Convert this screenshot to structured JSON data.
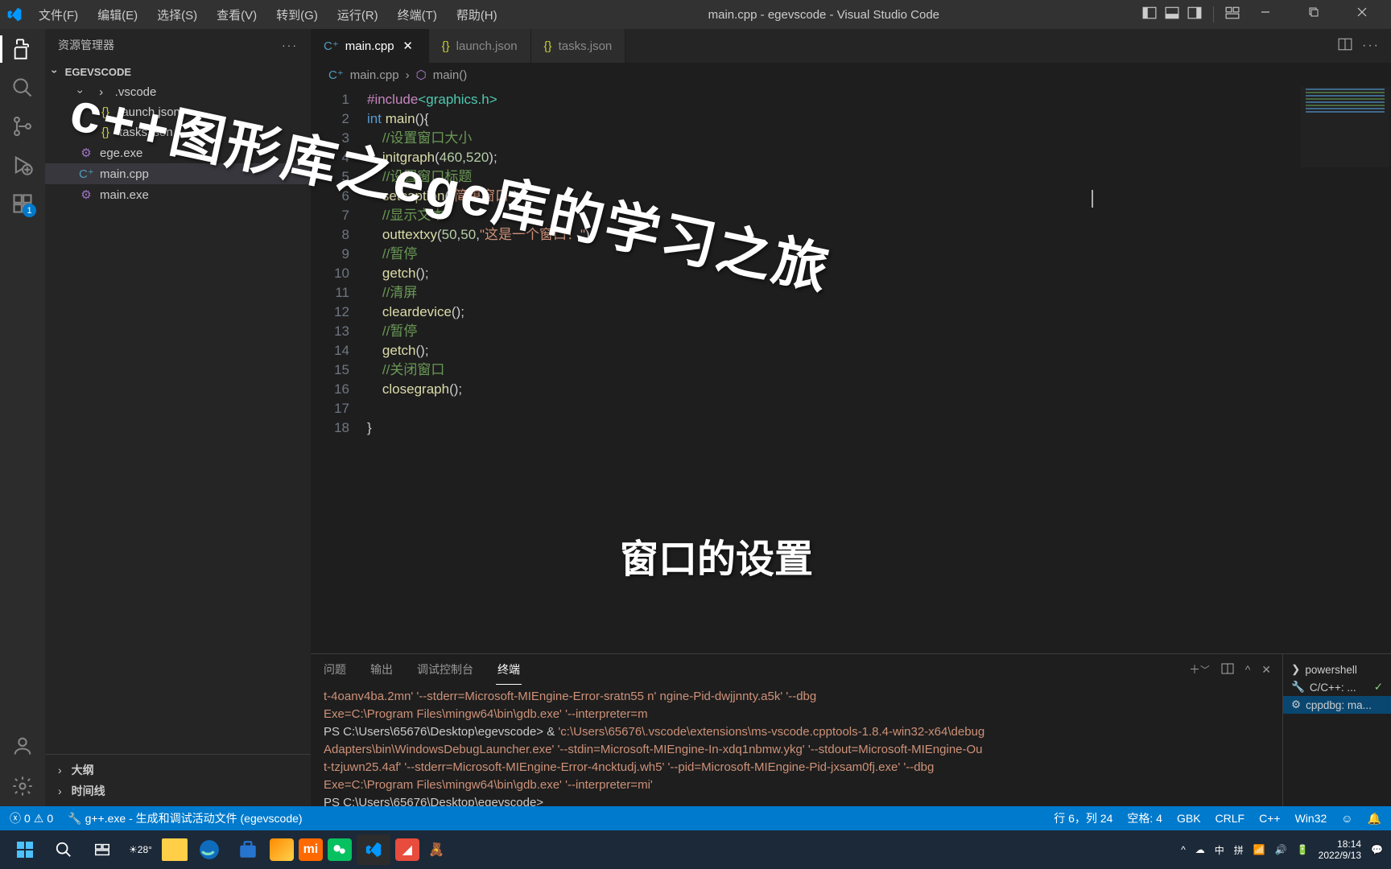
{
  "window": {
    "title": "main.cpp - egevscode - Visual Studio Code"
  },
  "menu": [
    "文件(F)",
    "编辑(E)",
    "选择(S)",
    "查看(V)",
    "转到(G)",
    "运行(R)",
    "终端(T)",
    "帮助(H)"
  ],
  "sidebar": {
    "title": "资源管理器",
    "root": "EGEVSCODE",
    "items": [
      {
        "label": ".vscode",
        "type": "folder",
        "indent": 1
      },
      {
        "label": "launch.json",
        "type": "json",
        "indent": 2
      },
      {
        "label": "tasks.json",
        "type": "json",
        "indent": 2
      },
      {
        "label": "ege.exe",
        "type": "exe",
        "indent": 1
      },
      {
        "label": "main.cpp",
        "type": "cpp",
        "indent": 1,
        "active": true
      },
      {
        "label": "main.exe",
        "type": "exe",
        "indent": 1
      }
    ],
    "outline": "大纲",
    "timeline": "时间线"
  },
  "tabs": [
    {
      "label": "main.cpp",
      "icon": "cpp",
      "active": true,
      "closable": true
    },
    {
      "label": "launch.json",
      "icon": "json"
    },
    {
      "label": "tasks.json",
      "icon": "json"
    }
  ],
  "breadcrumb": {
    "file": "main.cpp",
    "symbol": "main()"
  },
  "code": [
    {
      "n": 1,
      "html": "<span class='pp'>#include</span><span class='ty'>&lt;graphics.h&gt;</span>"
    },
    {
      "n": 2,
      "html": "<span class='kw'>int</span> <span class='fn'>main</span>(){"
    },
    {
      "n": 3,
      "html": "    <span class='cmt'>//设置窗口大小</span>"
    },
    {
      "n": 4,
      "html": "    <span class='fn'>initgraph</span>(<span class='num'>460</span>,<span class='num'>520</span>);"
    },
    {
      "n": 5,
      "html": "    <span class='cmt'>//设置窗口标题</span>"
    },
    {
      "n": 6,
      "html": "    <span class='fn'>setcaption</span>(<span class='str'>\"简单窗口\"</span>);"
    },
    {
      "n": 7,
      "html": "    <span class='cmt'>//显示文本</span>"
    },
    {
      "n": 8,
      "html": "    <span class='fn'>outtextxy</span>(<span class='num'>50</span>,<span class='num'>50</span>,<span class='str'>\"这是一个窗口！\"</span>);"
    },
    {
      "n": 9,
      "html": "    <span class='cmt'>//暂停</span>"
    },
    {
      "n": 10,
      "html": "    <span class='fn'>getch</span>();"
    },
    {
      "n": 11,
      "html": "    <span class='cmt'>//清屏</span>"
    },
    {
      "n": 12,
      "html": "    <span class='fn'>cleardevice</span>();"
    },
    {
      "n": 13,
      "html": "    <span class='cmt'>//暂停</span>"
    },
    {
      "n": 14,
      "html": "    <span class='fn'>getch</span>();"
    },
    {
      "n": 15,
      "html": "    <span class='cmt'>//关闭窗口</span>"
    },
    {
      "n": 16,
      "html": "    <span class='fn'>closegraph</span>();"
    },
    {
      "n": 17,
      "html": ""
    },
    {
      "n": 18,
      "html": "}"
    }
  ],
  "panel": {
    "tabs": [
      "问题",
      "输出",
      "调试控制台",
      "终端"
    ],
    "activeTab": 3,
    "sideTerminals": [
      {
        "label": "powershell",
        "icon": "ps"
      },
      {
        "label": "C/C++: ...",
        "icon": "wrench",
        "check": true
      },
      {
        "label": "cppdbg: ma...",
        "icon": "gear",
        "spin": true
      }
    ],
    "lines": [
      "<span class='y'>t-4oanv4ba.2mn'</span> <span class='y'>'--stderr=Microsoft-MIEngine-Error-sratn55    n'</span>                 <span class='y'>ngine-Pid-dwjjnnty.a5k'</span> <span class='y'>'--dbg</span>",
      "<span class='y'>Exe=C:\\Program Files\\mingw64\\bin\\gdb.exe'</span> <span class='y'>'--interpreter=m</span>",
      "PS C:\\Users\\65676\\Desktop\\egevscode&gt;  &amp; <span class='y'>'c:\\Users\\65676\\.vscode\\extensions\\ms-vscode.cpptools-1.8.4-win32-x64\\debug</span>",
      "<span class='y'>Adapters\\bin\\WindowsDebugLauncher.exe'</span> <span class='y'>'--stdin=Microsoft-MIEngine-In-xdq1nbmw.ykg'</span> <span class='y'>'--stdout=Microsoft-MIEngine-Ou</span>",
      "<span class='y'>t-tzjuwn25.4af'</span> <span class='y'>'--stderr=Microsoft-MIEngine-Error-4ncktudj.wh5'</span> <span class='y'>'--pid=Microsoft-MIEngine-Pid-jxsam0fj.exe'</span> <span class='y'>'--dbg</span>",
      "<span class='y'>Exe=C:\\Program Files\\mingw64\\bin\\gdb.exe'</span> <span class='y'>'--interpreter=mi'</span>",
      "PS C:\\Users\\65676\\Desktop\\egevscode&gt;"
    ]
  },
  "status": {
    "errors": "0",
    "warnings": "0",
    "task": "g++.exe - 生成和调试活动文件 (egevscode)",
    "lncol": "行 6，列 24",
    "spaces": "空格: 4",
    "enc": "GBK",
    "eol": "CRLF",
    "lang": "C++",
    "target": "Win32"
  },
  "taskbar": {
    "weather": "28°",
    "tray": [
      "^",
      "☁",
      "中",
      "拼",
      "📶",
      "🔊",
      "🔋"
    ],
    "time": "18:14",
    "date": "2022/9/13"
  },
  "overlays": {
    "t1": "c++图形库之ege库的学习之旅",
    "t2": "窗口的设置"
  },
  "ext_badge": "1"
}
